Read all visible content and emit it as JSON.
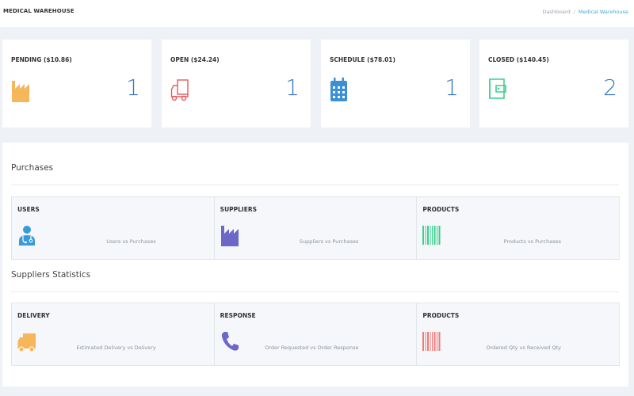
{
  "header": {
    "title": "MEDICAL WAREHOUSE",
    "breadcrumb": [
      "Dashboard",
      "Medical Warehouse"
    ]
  },
  "cards": [
    {
      "label": "PENDING ($10.86)",
      "count": "1",
      "icon": "factory-icon",
      "color": "#f5b65c"
    },
    {
      "label": "OPEN ($24.24)",
      "count": "1",
      "icon": "truck-icon",
      "color": "#e8585b"
    },
    {
      "label": "SCHEDULE ($78.01)",
      "count": "1",
      "icon": "calendar-icon",
      "color": "#3b8fd6"
    },
    {
      "label": "CLOSED ($140.45)",
      "count": "2",
      "icon": "wallet-icon",
      "color": "#3ccf8e"
    }
  ],
  "purchases": {
    "title": "Purchases",
    "items": [
      {
        "title": "USERS",
        "desc": "Users vs Purchases",
        "icon": "doctor-icon",
        "color": "#3a9ad9"
      },
      {
        "title": "SUPPLIERS",
        "desc": "Suppliers vs Purchases",
        "icon": "factory-icon",
        "color": "#6b68c8"
      },
      {
        "title": "PRODUCTS",
        "desc": "Products vs Purchases",
        "icon": "barcode-icon",
        "color": "#3ccf8e"
      }
    ]
  },
  "supplier_stats": {
    "title": "Suppliers Statistics",
    "items": [
      {
        "title": "DELIVERY",
        "desc": "Estimated Delivery vs Delivery",
        "icon": "truck-icon",
        "color": "#f5b65c"
      },
      {
        "title": "RESPONSE",
        "desc": "Order Requested vs Order Response",
        "icon": "phone-icon",
        "color": "#6b68c8"
      },
      {
        "title": "PRODUCTS",
        "desc": "Ordered Qty vs Received Qty",
        "icon": "barcode-icon",
        "color": "#f07a7a"
      }
    ]
  }
}
